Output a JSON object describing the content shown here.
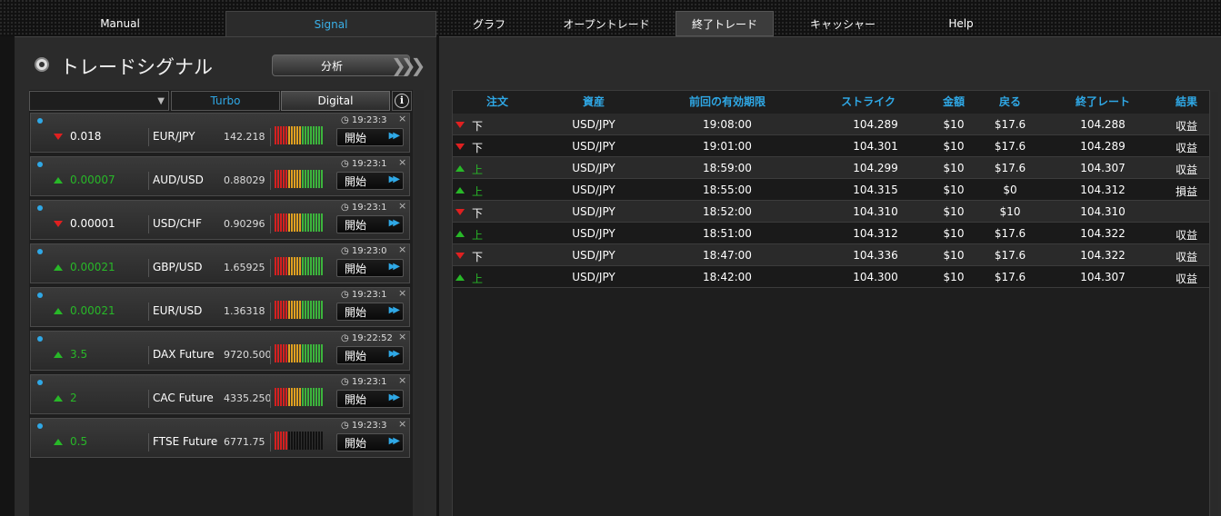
{
  "nav": {
    "tabs": [
      {
        "label": "Manual"
      },
      {
        "label": "Signal"
      },
      {
        "label": "グラフ"
      },
      {
        "label": "オープントレード"
      },
      {
        "label": "終了トレード"
      },
      {
        "label": "キャッシャー"
      },
      {
        "label": "Help"
      }
    ]
  },
  "signal": {
    "title": "トレードシグナル",
    "analyze_label": "分析",
    "filter": {
      "turbo": "Turbo",
      "digital": "Digital"
    },
    "rows": [
      {
        "change": "0.018",
        "direction": "down",
        "asset": "EUR/JPY",
        "rate": "142.218",
        "time": "19:23:3",
        "start": "開始",
        "strength": 18,
        "bars": [
          "r",
          "r",
          "r",
          "r",
          "r",
          "y",
          "y",
          "y",
          "y",
          "y",
          "g",
          "g",
          "g",
          "g",
          "g",
          "g",
          "g",
          "g"
        ]
      },
      {
        "change": "0.00007",
        "direction": "up",
        "asset": "AUD/USD",
        "rate": "0.88029",
        "time": "19:23:1",
        "start": "開始",
        "strength": 18,
        "bars": [
          "r",
          "r",
          "r",
          "r",
          "r",
          "y",
          "y",
          "y",
          "y",
          "y",
          "g",
          "g",
          "g",
          "g",
          "g",
          "g",
          "g",
          "g"
        ]
      },
      {
        "change": "0.00001",
        "direction": "down",
        "asset": "USD/CHF",
        "rate": "0.90296",
        "time": "19:23:1",
        "start": "開始",
        "strength": 18,
        "bars": [
          "r",
          "r",
          "r",
          "r",
          "r",
          "y",
          "y",
          "y",
          "y",
          "y",
          "g",
          "g",
          "g",
          "g",
          "g",
          "g",
          "g",
          "g"
        ]
      },
      {
        "change": "0.00021",
        "direction": "up",
        "asset": "GBP/USD",
        "rate": "1.65925",
        "time": "19:23:0",
        "start": "開始",
        "strength": 18,
        "bars": [
          "r",
          "r",
          "r",
          "r",
          "r",
          "y",
          "y",
          "y",
          "y",
          "y",
          "g",
          "g",
          "g",
          "g",
          "g",
          "g",
          "g",
          "g"
        ]
      },
      {
        "change": "0.00021",
        "direction": "up",
        "asset": "EUR/USD",
        "rate": "1.36318",
        "time": "19:23:1",
        "start": "開始",
        "strength": 18,
        "bars": [
          "r",
          "r",
          "r",
          "r",
          "r",
          "y",
          "y",
          "y",
          "y",
          "y",
          "g",
          "g",
          "g",
          "g",
          "g",
          "g",
          "g",
          "g"
        ]
      },
      {
        "change": "3.5",
        "direction": "up",
        "asset": "DAX Future",
        "rate": "9720.500",
        "time": "19:22:52",
        "start": "開始",
        "strength": 18,
        "bars": [
          "r",
          "r",
          "r",
          "r",
          "r",
          "y",
          "y",
          "y",
          "y",
          "y",
          "g",
          "g",
          "g",
          "g",
          "g",
          "g",
          "g",
          "g"
        ]
      },
      {
        "change": "2",
        "direction": "up",
        "asset": "CAC Future",
        "rate": "4335.250",
        "time": "19:23:1",
        "start": "開始",
        "strength": 18,
        "bars": [
          "r",
          "r",
          "r",
          "r",
          "r",
          "y",
          "y",
          "y",
          "y",
          "y",
          "g",
          "g",
          "g",
          "g",
          "g",
          "g",
          "g",
          "g"
        ]
      },
      {
        "change": "0.5",
        "direction": "up",
        "asset": "FTSE Future",
        "rate": "6771.75",
        "time": "19:23:3",
        "start": "開始",
        "strength": 5,
        "bars": [
          "r",
          "r",
          "r",
          "r",
          "r",
          "k",
          "k",
          "k",
          "k",
          "k",
          "k",
          "k",
          "k",
          "k",
          "k",
          "k",
          "k",
          "k"
        ]
      }
    ]
  },
  "trades": {
    "headers": [
      "注文",
      "資産",
      "前回の有効期限",
      "ストライク",
      "金額",
      "戻る",
      "終了レート",
      "結果"
    ],
    "rows": [
      {
        "dir": "down",
        "label": "下",
        "asset": "USD/JPY",
        "expiry": "19:08:00",
        "strike": "104.289",
        "amount": "$10",
        "return": "$17.6",
        "close": "104.288",
        "result": "収益"
      },
      {
        "dir": "down",
        "label": "下",
        "asset": "USD/JPY",
        "expiry": "19:01:00",
        "strike": "104.301",
        "amount": "$10",
        "return": "$17.6",
        "close": "104.289",
        "result": "収益"
      },
      {
        "dir": "up",
        "label": "上",
        "asset": "USD/JPY",
        "expiry": "18:59:00",
        "strike": "104.299",
        "amount": "$10",
        "return": "$17.6",
        "close": "104.307",
        "result": "収益"
      },
      {
        "dir": "up",
        "label": "上",
        "asset": "USD/JPY",
        "expiry": "18:55:00",
        "strike": "104.315",
        "amount": "$10",
        "return": "$0",
        "close": "104.312",
        "result": "損益"
      },
      {
        "dir": "down",
        "label": "下",
        "asset": "USD/JPY",
        "expiry": "18:52:00",
        "strike": "104.310",
        "amount": "$10",
        "return": "$10",
        "close": "104.310",
        "result": ""
      },
      {
        "dir": "up",
        "label": "上",
        "asset": "USD/JPY",
        "expiry": "18:51:00",
        "strike": "104.312",
        "amount": "$10",
        "return": "$17.6",
        "close": "104.322",
        "result": "収益"
      },
      {
        "dir": "down",
        "label": "下",
        "asset": "USD/JPY",
        "expiry": "18:47:00",
        "strike": "104.336",
        "amount": "$10",
        "return": "$17.6",
        "close": "104.322",
        "result": "収益"
      },
      {
        "dir": "up",
        "label": "上",
        "asset": "USD/JPY",
        "expiry": "18:42:00",
        "strike": "104.300",
        "amount": "$10",
        "return": "$17.6",
        "close": "104.307",
        "result": "収益"
      }
    ]
  },
  "colors": {
    "accent": "#2fa8e6",
    "up": "#28b828",
    "down": "#e02020",
    "bar_red": "#d42020",
    "bar_yellow": "#e0a020",
    "bar_green": "#3cb43c",
    "bar_off": "#111111"
  }
}
